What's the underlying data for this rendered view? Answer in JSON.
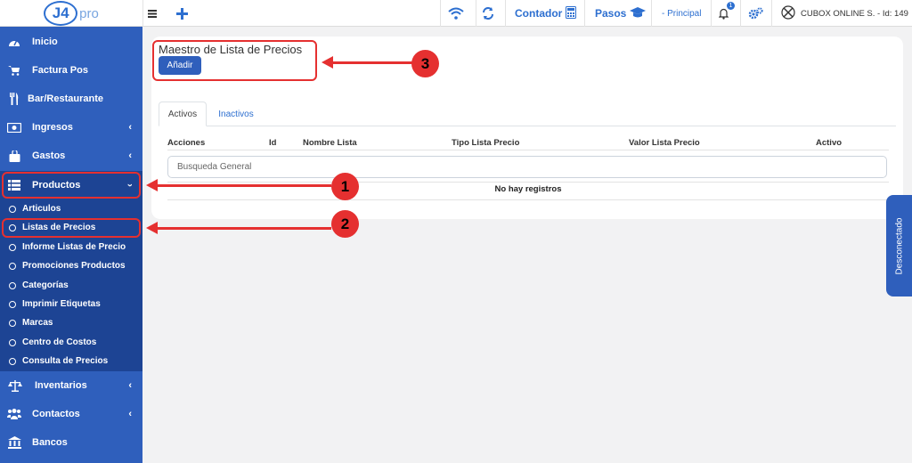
{
  "topbar": {
    "logo_text": "J4",
    "logo_suffix": "pro",
    "menu_icon": "hamburger-icon",
    "add_icon": "plus-icon",
    "wifi_icon": "wifi-icon",
    "sync_icon": "sync-icon",
    "counter_label": "Contador",
    "counter_icon": "calculator-icon",
    "steps_label": "Pasos",
    "steps_icon": "graduation-cap-icon",
    "branch_label": "- Principal",
    "notification_count": "1",
    "company_label": "CUBOX ONLINE S. - Id: 149"
  },
  "sidebar": {
    "items": [
      {
        "label": "Inicio",
        "icon": "dashboard-icon"
      },
      {
        "label": "Factura Pos",
        "icon": "cart-icon"
      },
      {
        "label": "Bar/Restaurante",
        "icon": "utensils-icon"
      },
      {
        "label": "Ingresos",
        "icon": "money-icon"
      },
      {
        "label": "Gastos",
        "icon": "bag-icon"
      },
      {
        "label": "Productos",
        "icon": "list-icon"
      },
      {
        "label": "Inventarios",
        "icon": "balance-scale-icon"
      },
      {
        "label": "Contactos",
        "icon": "users-icon"
      },
      {
        "label": "Bancos",
        "icon": "bank-icon"
      }
    ],
    "sub_items": [
      {
        "label": "Articulos"
      },
      {
        "label": "Listas de Precios"
      },
      {
        "label": "Informe Listas de Precio"
      },
      {
        "label": "Promociones Productos"
      },
      {
        "label": "Categorías"
      },
      {
        "label": "Imprimir Etiquetas"
      },
      {
        "label": "Marcas"
      },
      {
        "label": "Centro de Costos"
      },
      {
        "label": "Consulta de Precios"
      }
    ]
  },
  "main": {
    "title": "Maestro de Lista de Precios",
    "add_button": "Añadir",
    "tabs": [
      {
        "label": "Activos"
      },
      {
        "label": "Inactivos"
      }
    ],
    "columns": [
      "Acciones",
      "Id",
      "Nombre Lista",
      "Tipo Lista Precio",
      "Valor Lista Precio",
      "Activo"
    ],
    "search_placeholder": "Busqueda General",
    "empty_text": "No hay registros"
  },
  "status_tab": "Desconectado",
  "annotations": {
    "markers": [
      "1",
      "2",
      "3"
    ],
    "color": "#e53030"
  },
  "colors": {
    "sidebar": "#2f5fbc",
    "sidebar_active": "#1d4494",
    "accent": "#2d6fd0"
  }
}
